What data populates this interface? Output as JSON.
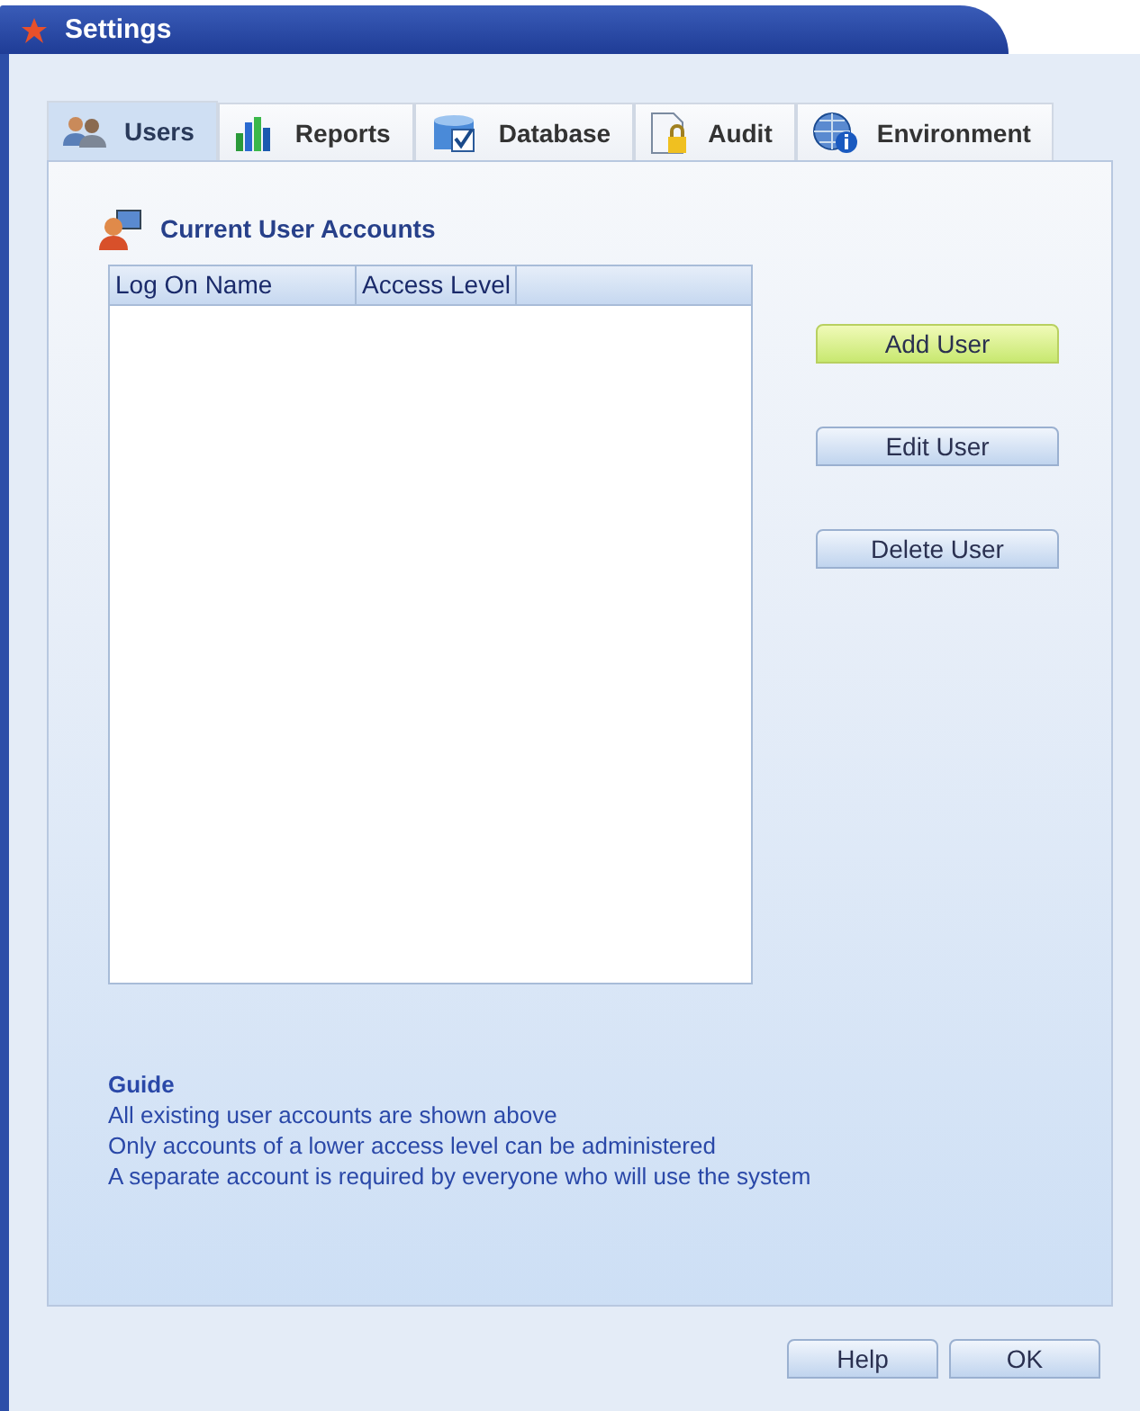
{
  "window": {
    "title": "Settings"
  },
  "tabs": [
    {
      "label": "Users",
      "selected": true
    },
    {
      "label": "Reports",
      "selected": false
    },
    {
      "label": "Database",
      "selected": false
    },
    {
      "label": "Audit",
      "selected": false
    },
    {
      "label": "Environment",
      "selected": false
    }
  ],
  "section_title": "Current User Accounts",
  "table": {
    "columns": [
      "Log On Name",
      "Access Level"
    ]
  },
  "actions": [
    {
      "label": "Add User",
      "highlighted": true
    },
    {
      "label": "Edit User",
      "highlighted": false
    },
    {
      "label": "Delete User",
      "highlighted": false
    }
  ],
  "guide": {
    "title": "Guide",
    "lines": [
      "All existing user accounts are shown above",
      "Only accounts of a lower access level can be administered",
      "A separate account is required by everyone who will use the system"
    ]
  },
  "buttons": [
    "Help",
    "OK"
  ]
}
